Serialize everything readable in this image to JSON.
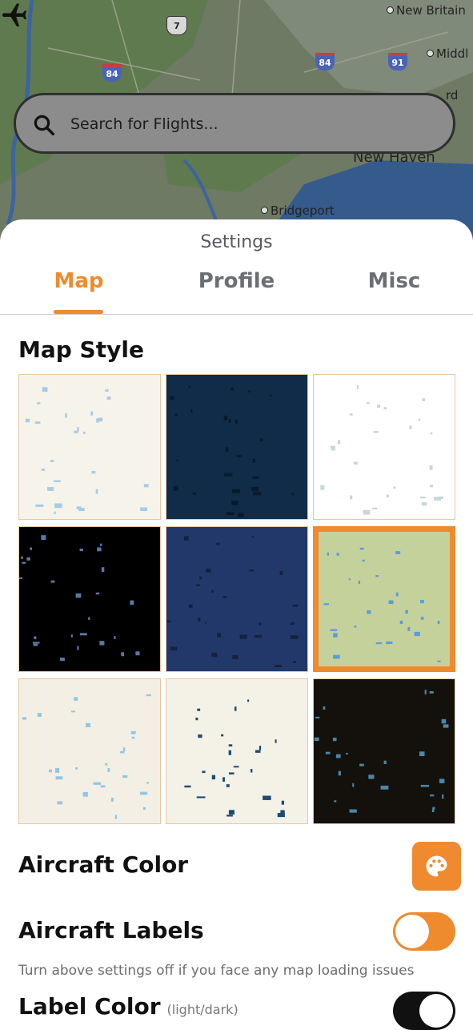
{
  "map": {
    "labels": {
      "new_britain": "New Britain",
      "middletown": "Middl",
      "new_haven": "New Haven",
      "bridgeport": "Bridgeport",
      "rd": "rd"
    },
    "shields": {
      "us_route": "7",
      "i84_left": "84",
      "i84_right": "84",
      "i91": "91"
    }
  },
  "search": {
    "placeholder": "Search for Flights..."
  },
  "settings": {
    "title": "Settings",
    "tabs": [
      "Map",
      "Profile",
      "Misc"
    ],
    "active_tab": "Map",
    "map_style_title": "Map Style",
    "map_styles": [
      {
        "name": "light",
        "bg": "#f6f3ea",
        "water": "#a6cbe6"
      },
      {
        "name": "navy",
        "bg": "#112c48",
        "water": "#081a2c"
      },
      {
        "name": "white",
        "bg": "#ffffff",
        "water": "#c7d6d8"
      },
      {
        "name": "black",
        "bg": "#000000",
        "water": "#5a78a6"
      },
      {
        "name": "blue",
        "bg": "#23386a",
        "water": "#14223e"
      },
      {
        "name": "green",
        "bg": "#c5d19a",
        "water": "#5a9be0",
        "selected": true
      },
      {
        "name": "terrain-light",
        "bg": "#f3efe4",
        "water": "#8ec7e6"
      },
      {
        "name": "cream-dark-water",
        "bg": "#f4f1e6",
        "water": "#1e4a73"
      },
      {
        "name": "dark-terrain",
        "bg": "#14110c",
        "water": "#4c86a8"
      }
    ],
    "aircraft_color_label": "Aircraft Color",
    "aircraft_labels_label": "Aircraft Labels",
    "aircraft_labels_on": true,
    "note": "Turn above settings off if you face any map loading issues",
    "label_color_label": "Label Color",
    "label_color_hint": "(light/dark)",
    "accent": "#ef8a2e"
  }
}
